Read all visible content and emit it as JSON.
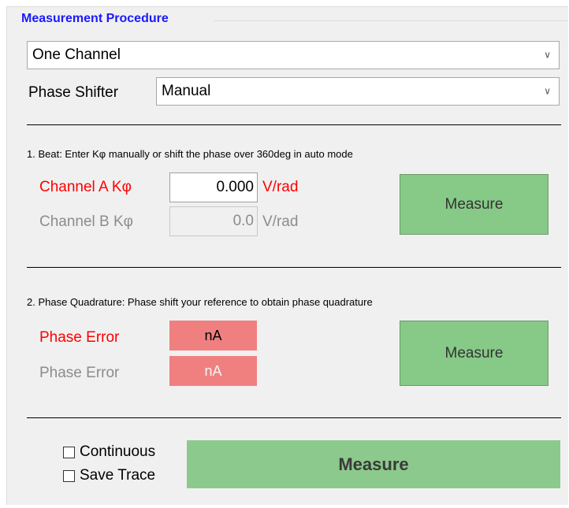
{
  "group": {
    "title": "Measurement Procedure"
  },
  "mode_select": {
    "value": "One Channel"
  },
  "phase_shifter": {
    "label": "Phase Shifter",
    "value": "Manual"
  },
  "beat": {
    "heading": "1. Beat: Enter Kφ manually or shift the phase over 360deg in auto mode",
    "channel_a": {
      "label": "Channel A Kφ",
      "value": "0.000",
      "unit": "V/rad"
    },
    "channel_b": {
      "label": "Channel B Kφ",
      "value": "0.0",
      "unit": "V/rad"
    },
    "measure_label": "Measure"
  },
  "quadrature": {
    "heading": "2. Phase Quadrature: Phase shift your reference to obtain phase quadrature",
    "error_a": {
      "label": "Phase Error",
      "value": "nA"
    },
    "error_b": {
      "label": "Phase Error",
      "value": "nA"
    },
    "measure_label": "Measure"
  },
  "footer": {
    "continuous_label": "Continuous",
    "continuous_checked": false,
    "save_trace_label": "Save Trace",
    "save_trace_checked": false,
    "measure_label": "Measure"
  },
  "colors": {
    "title_blue": "#1a1aff",
    "label_red": "#ff0000",
    "button_green": "#87c987",
    "error_red": "#f08080",
    "disabled_gray": "#8c8c8c"
  }
}
